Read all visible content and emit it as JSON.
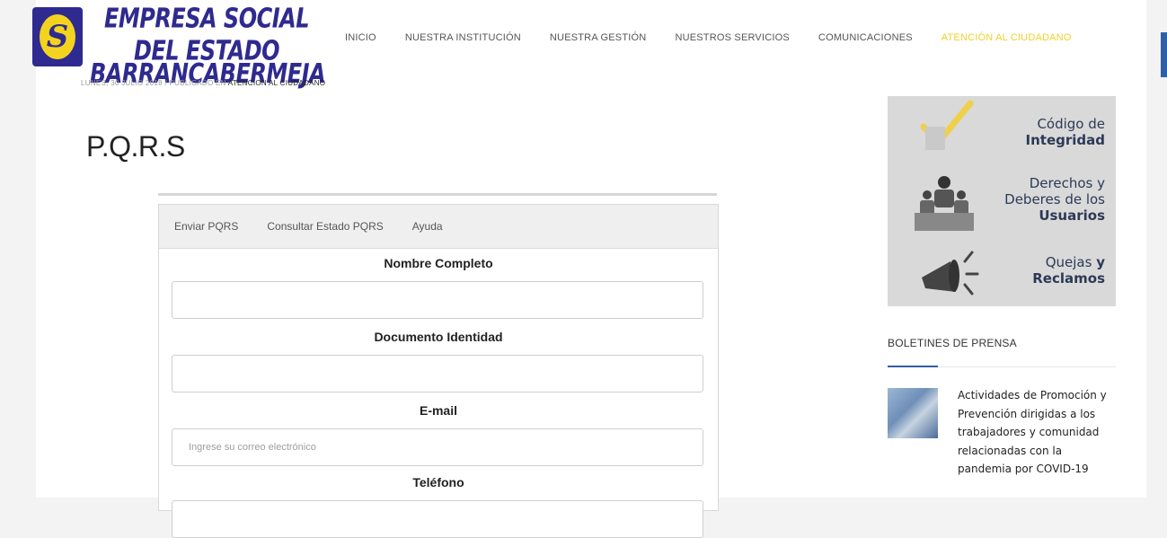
{
  "header": {
    "logo_letter": "S",
    "brand_line1": "EMPRESA SOCIAL DEL ESTADO",
    "brand_line2": "BARRANCABERMEJA",
    "nav": [
      {
        "label": "INICIO"
      },
      {
        "label": "NUESTRA INSTITUCIÓN"
      },
      {
        "label": "NUESTRA GESTIÓN"
      },
      {
        "label": "NUESTROS SERVICIOS"
      },
      {
        "label": "COMUNICACIONES"
      },
      {
        "label": "ATENCIÓN AL CIUDADANO"
      }
    ]
  },
  "post": {
    "date": "LUNES, 30 JULIO 2018",
    "separator": "/",
    "published_in": "PUBLICADO EN",
    "category": "ATENCION AL CIUDADANO",
    "title": "P.Q.R.S"
  },
  "form": {
    "tabs": [
      "Enviar PQRS",
      "Consultar Estado PQRS",
      "Ayuda"
    ],
    "fields": {
      "name_label": "Nombre Completo",
      "document_label": "Documento Identidad",
      "email_label": "E-mail",
      "email_placeholder": "Ingrese su correo electrónico",
      "phone_label": "Teléfono"
    }
  },
  "sidebar": {
    "banner": {
      "item1_line1": "Código de",
      "item1_line2": "Integridad",
      "item2_line1": "Derechos y",
      "item2_line2": "Deberes de los",
      "item2_line3": "Usuarios",
      "item3_line1_a": "Quejas",
      "item3_line1_b": "y",
      "item3_line2": "Reclamos"
    },
    "heading": "BOLETINES DE PRENSA",
    "news_title": "Actividades de Promoción y Prevención dirigidas a los trabajadores y comunidad relacionadas con la pandemia por COVID-19"
  },
  "colors": {
    "brand_blue": "#2f2a8f",
    "brand_yellow": "#f4d31e",
    "nav_active": "#f0d02a"
  }
}
